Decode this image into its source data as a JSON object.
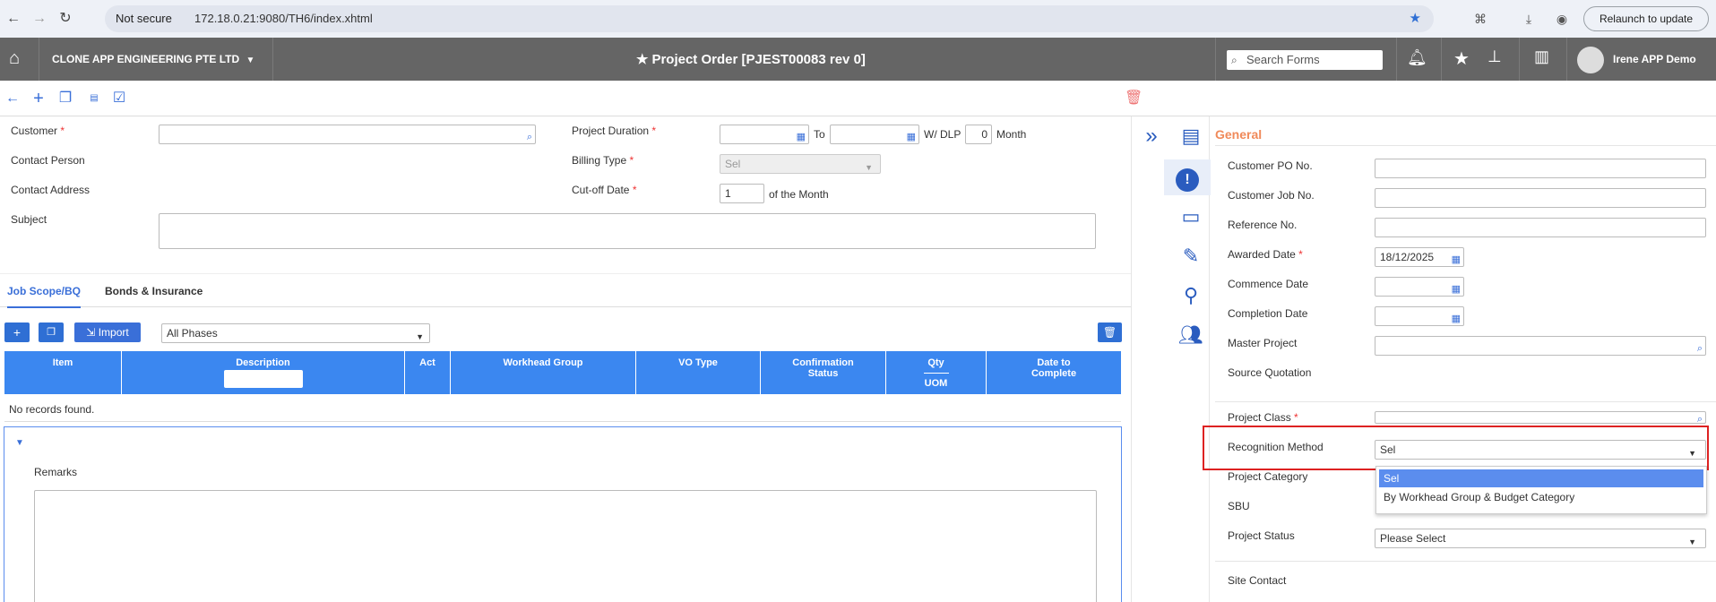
{
  "browser": {
    "not_secure": "Not secure",
    "url": "172.18.0.21:9080/TH6/index.xhtml",
    "relaunch": "Relaunch to update"
  },
  "header": {
    "company": "CLONE APP ENGINEERING PTE LTD",
    "title": "Project Order [PJEST00083 rev 0]",
    "search_placeholder": "Search Forms",
    "user": "Irene APP Demo"
  },
  "form": {
    "customer": "Customer",
    "contact_person": "Contact Person",
    "contact_address": "Contact Address",
    "subject": "Subject",
    "project_duration": "Project Duration",
    "to": "To",
    "wdlp": "W/ DLP",
    "dlp_value": "0",
    "month": "Month",
    "billing_type": "Billing Type",
    "billing_value": "Sel",
    "cutoff": "Cut-off Date",
    "cutoff_value": "1",
    "of_month": "of the Month",
    "req": "*"
  },
  "tabs": {
    "job_scope": "Job Scope/BQ",
    "bonds": "Bonds & Insurance"
  },
  "table": {
    "import": "Import",
    "phase": "All Phases",
    "columns": [
      "Item",
      "Description",
      "Act",
      "Workhead Group",
      "VO Type",
      "Confirmation Status",
      "Qty",
      "UOM",
      "Date to Complete"
    ],
    "empty": "No records found."
  },
  "remarks": "Remarks",
  "right": {
    "general": "General",
    "customer_po": "Customer PO No.",
    "customer_job": "Customer Job No.",
    "reference": "Reference No.",
    "awarded": "Awarded Date",
    "awarded_value": "18/12/2025",
    "commence": "Commence Date",
    "completion": "Completion Date",
    "master": "Master Project",
    "source": "Source Quotation",
    "project_class": "Project Class",
    "recognition": "Recognition Method",
    "recognition_value": "Sel",
    "project_category": "Project Category",
    "sbu": "SBU",
    "project_status": "Project Status",
    "status_value": "Please Select",
    "site_contact": "Site Contact",
    "options": [
      "Sel",
      "By Workhead Group & Budget Category"
    ]
  }
}
